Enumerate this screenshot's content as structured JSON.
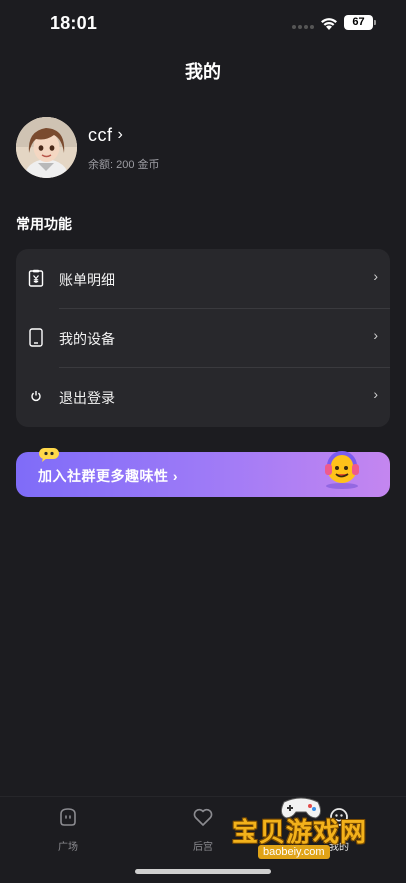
{
  "status_bar": {
    "time": "18:01",
    "battery": "67"
  },
  "header": {
    "title": "我的"
  },
  "profile": {
    "username": "ccf",
    "chevron": "›",
    "balance": "余额: 200 金币"
  },
  "section": {
    "title": "常用功能"
  },
  "menu": {
    "items": [
      {
        "label": "账单明细",
        "icon": "receipt-yen-icon"
      },
      {
        "label": "我的设备",
        "icon": "phone-device-icon"
      },
      {
        "label": "退出登录",
        "icon": "power-icon"
      }
    ],
    "chevron": "›"
  },
  "banner": {
    "text": "加入社群更多趣味性 ›"
  },
  "tabbar": {
    "tabs": [
      {
        "label": "广场",
        "icon": "plaza-icon"
      },
      {
        "label": "后宫",
        "icon": "heart-icon"
      },
      {
        "label": "我的",
        "icon": "profile-face-icon"
      }
    ]
  },
  "watermark": {
    "text": "宝贝游戏网",
    "url": "baobeiy.com"
  },
  "colors": {
    "background": "#1c1c20",
    "card": "#28282c",
    "banner_start": "#7f6cf8",
    "banner_end": "#c486f0",
    "watermark": "#f3b21b"
  }
}
